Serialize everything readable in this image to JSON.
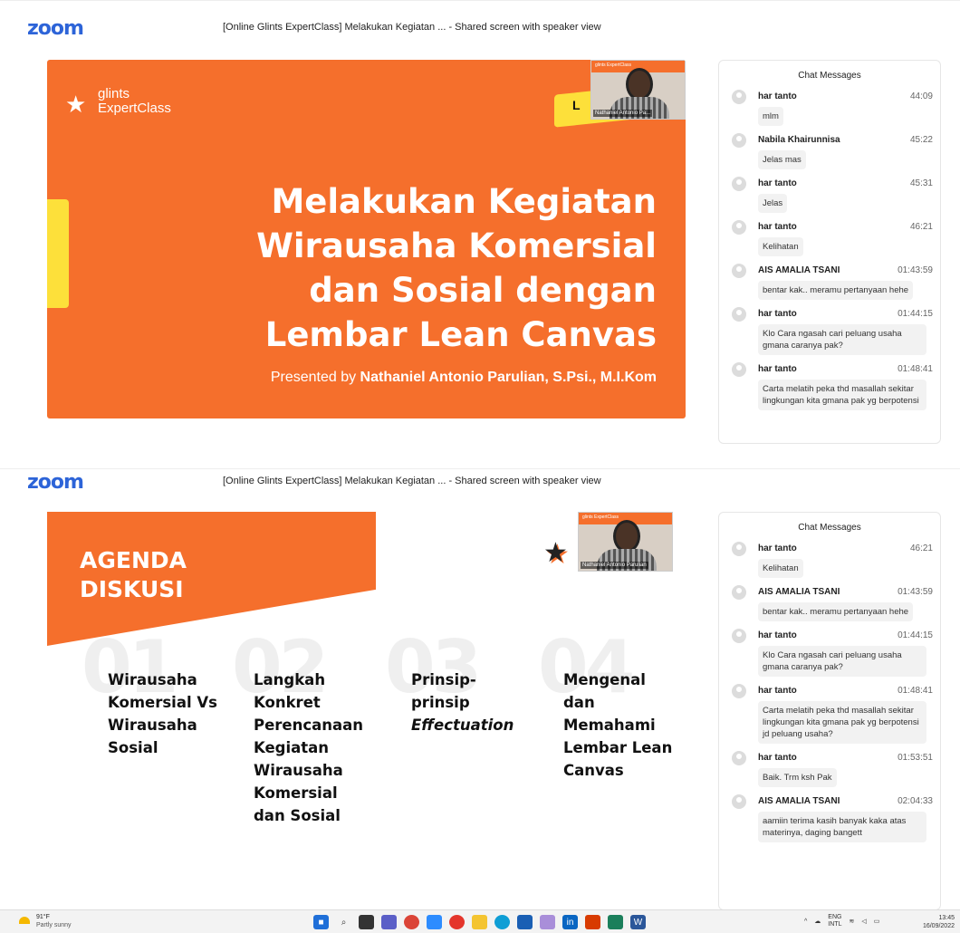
{
  "pane1": {
    "app_logo": "zoom",
    "window_title": "[Online Glints ExpertClass] Melakukan Kegiatan ...  - Shared screen with speaker view",
    "slide": {
      "brand_line1": "glints",
      "brand_line2": "ExpertClass",
      "title_lines": [
        "Melakukan Kegiatan",
        "Wirausaha Komersial",
        "dan Sosial dengan",
        "Lembar Lean Canvas"
      ],
      "presented_prefix": "Presented by ",
      "presenter": "Nathaniel Antonio Parulian, S.Psi., M.I.Kom",
      "cam_letter": "L",
      "cam_name": "Nathaniel Antonio Pa...",
      "cam_brand": "glints ExpertClass"
    },
    "chat": {
      "header": "Chat Messages",
      "messages": [
        {
          "sender": "har tanto",
          "time": "44:09",
          "text": "mlm"
        },
        {
          "sender": "Nabila Khairunnisa",
          "time": "45:22",
          "text": "Jelas mas"
        },
        {
          "sender": "har tanto",
          "time": "45:31",
          "text": "Jelas"
        },
        {
          "sender": "har tanto",
          "time": "46:21",
          "text": "Kelihatan"
        },
        {
          "sender": "AIS AMALIA TSANI",
          "time": "01:43:59",
          "text": "bentar kak.. meramu pertanyaan hehe"
        },
        {
          "sender": "har tanto",
          "time": "01:44:15",
          "text": "Klo Cara ngasah cari peluang usaha gmana caranya pak?"
        },
        {
          "sender": "har tanto",
          "time": "01:48:41",
          "text": "Carta melatih peka thd masallah sekitar lingkungan kita gmana pak yg berpotensi"
        }
      ]
    }
  },
  "pane2": {
    "app_logo": "zoom",
    "window_title": "[Online Glints ExpertClass] Melakukan Kegiatan ...  - Shared screen with speaker view",
    "slide": {
      "agenda_line1": "AGENDA",
      "agenda_line2": "DISKUSI",
      "cam_name": "Nathaniel Antonio Parulian",
      "cam_brand": "glints ExpertClass",
      "items": [
        {
          "num": "01",
          "lines": [
            "Wirausaha",
            "Komersial Vs",
            "Wirausaha",
            "Sosial"
          ]
        },
        {
          "num": "02",
          "lines": [
            "Langkah",
            "Konkret",
            "Perencanaan",
            "Kegiatan",
            "Wirausaha",
            "Komersial",
            "dan Sosial"
          ]
        },
        {
          "num": "03",
          "lines": [
            "Prinsip-",
            "prinsip",
            "Effectuation"
          ]
        },
        {
          "num": "04",
          "lines": [
            "Mengenal",
            "dan",
            "Memahami",
            "Lembar Lean",
            "Canvas"
          ]
        }
      ]
    },
    "chat": {
      "header": "Chat Messages",
      "messages": [
        {
          "sender": "har tanto",
          "time": "46:21",
          "text": "Kelihatan"
        },
        {
          "sender": "AIS AMALIA TSANI",
          "time": "01:43:59",
          "text": "bentar kak.. meramu pertanyaan hehe"
        },
        {
          "sender": "har tanto",
          "time": "01:44:15",
          "text": "Klo Cara ngasah cari peluang usaha gmana caranya pak?"
        },
        {
          "sender": "har tanto",
          "time": "01:48:41",
          "text": "Carta melatih peka thd masallah sekitar lingkungan kita gmana pak yg berpotensi jd peluang usaha?"
        },
        {
          "sender": "har tanto",
          "time": "01:53:51",
          "text": "Baik. Trm ksh Pak"
        },
        {
          "sender": "AIS AMALIA TSANI",
          "time": "02:04:33",
          "text": "aamiin terima kasih banyak kaka atas materinya, daging bangett"
        }
      ]
    }
  },
  "taskbar": {
    "temperature": "91°F",
    "weather": "Partly sunny",
    "lang_line1": "ENG",
    "lang_line2": "INTL",
    "time": "13:45",
    "date": "16/09/2022",
    "icons": [
      "windows-start",
      "search",
      "task-view",
      "chat",
      "chrome",
      "zoom",
      "record",
      "file-explorer",
      "edge",
      "mail",
      "photos",
      "linkedin",
      "office",
      "store",
      "word"
    ]
  },
  "colors": {
    "accent": "#f56f2c",
    "zoom_blue": "#2d64d8",
    "yellow": "#fde03a"
  }
}
